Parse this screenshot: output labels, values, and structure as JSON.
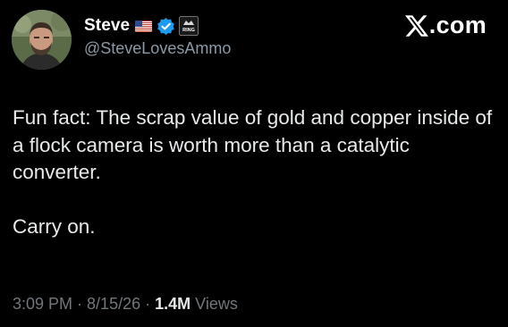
{
  "author": {
    "display_name": "Steve",
    "handle": "@SteveLovesAmmo",
    "flag_icon": "us-flag-icon",
    "verified_icon": "verified-badge-icon",
    "affiliate_badge_text": "RING",
    "verified_color": "#1d9bf0"
  },
  "brand": {
    "label": ".com",
    "icon": "x-logo-icon"
  },
  "post": {
    "paragraphs": [
      "Fun fact: The scrap value of gold and copper inside of a flock camera is worth more than a catalytic converter.",
      "Carry on."
    ]
  },
  "meta": {
    "time": "3:09 PM",
    "separator": "·",
    "date": "8/15/26",
    "views_count": "1.4M",
    "views_label": "Views"
  },
  "colors": {
    "background": "#000000",
    "text": "#e7e9ea",
    "secondary": "#71767b"
  }
}
